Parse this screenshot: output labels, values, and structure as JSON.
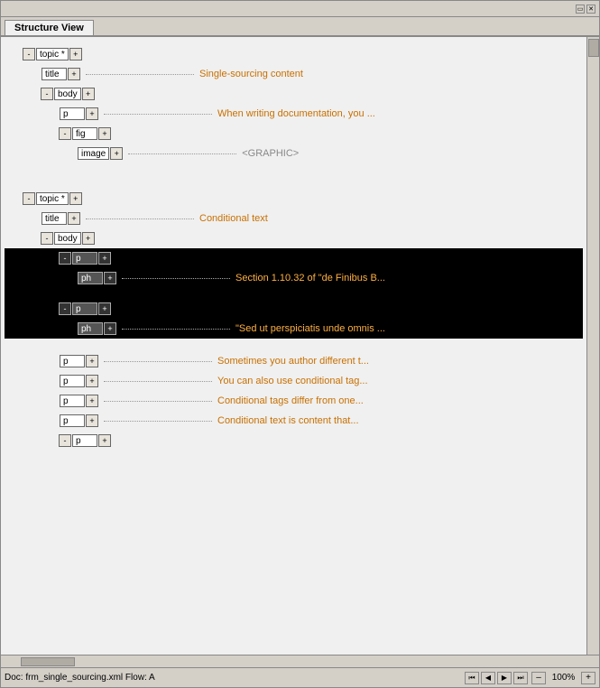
{
  "window": {
    "title": "Structure View",
    "tab_label": "Structure View"
  },
  "status": {
    "doc": "Doc: frm_single_sourcing.xml  Flow: A",
    "zoom": "100%"
  },
  "tree": {
    "topic1": {
      "tag": "topic",
      "star": true,
      "title_content": "Single-sourcing content",
      "body_content": "",
      "p_content": "When writing documentation, you ...",
      "fig_content": "",
      "image_content": "<GRAPHIC>"
    },
    "topic2": {
      "tag": "topic",
      "star": true,
      "title_content": "Conditional text",
      "body_content": "",
      "p1_content": "Section 1.10.32 of \"de Finibus B...",
      "p2_content": "\"Sed ut perspiciatis unde omnis ...",
      "p3_content": "Sometimes you author different t...",
      "p4_content": "You can also use conditional tag...",
      "p5_content": "Conditional tags differ from one...",
      "p6_content": "Conditional text is content that...",
      "ph1_content": "Section 1.10.32 of \"de Finibus B...",
      "ph2_content": "\"Sed ut perspiciatis unde omnis ..."
    }
  },
  "nav": {
    "first": "⏮",
    "prev": "◀",
    "next": "▶",
    "last": "⏭"
  },
  "zoom_minus": "–",
  "zoom_plus": "+"
}
